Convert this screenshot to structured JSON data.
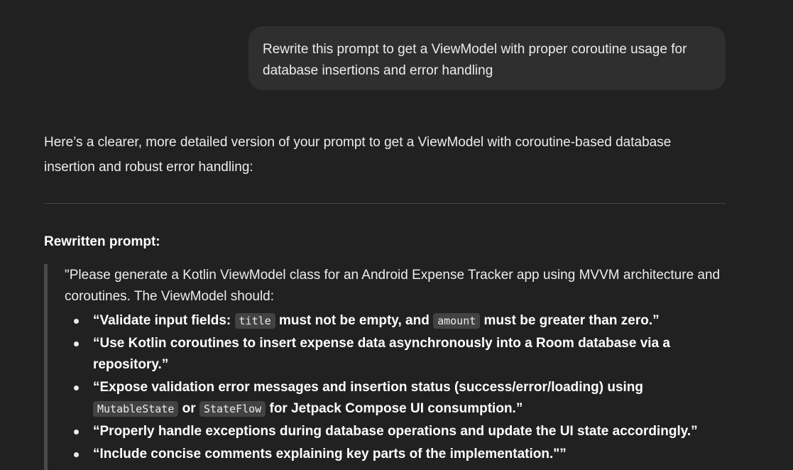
{
  "user_message": {
    "text": "Rewrite this prompt to get a ViewModel with proper coroutine usage for database insertions and error handling"
  },
  "assistant": {
    "intro": "Here’s a clearer, more detailed version of your prompt to get a ViewModel with coroutine-based database insertion and robust error handling:",
    "heading": "Rewritten prompt:",
    "quote_intro": "\"Please generate a Kotlin ViewModel class for an Android Expense Tracker app using MVVM architecture and coroutines. The ViewModel should:",
    "items": [
      {
        "part1": "“Validate input fields: ",
        "code1": "title",
        "part2": " must not be empty, and ",
        "code2": "amount",
        "part3": " must be greater than zero.”"
      },
      {
        "text": "“Use Kotlin coroutines to insert expense data asynchronously into a Room database via a repository.”"
      },
      {
        "part1": "“Expose validation error messages and insertion status (success/error/loading) using ",
        "code1": "MutableState",
        "part2": " or ",
        "code2": "StateFlow",
        "part3": " for Jetpack Compose UI consumption.”"
      },
      {
        "text": "“Properly handle exceptions during database operations and update the UI state accordingly.”"
      },
      {
        "text": "“Include concise comments explaining key parts of the implementation.\"”"
      }
    ]
  }
}
